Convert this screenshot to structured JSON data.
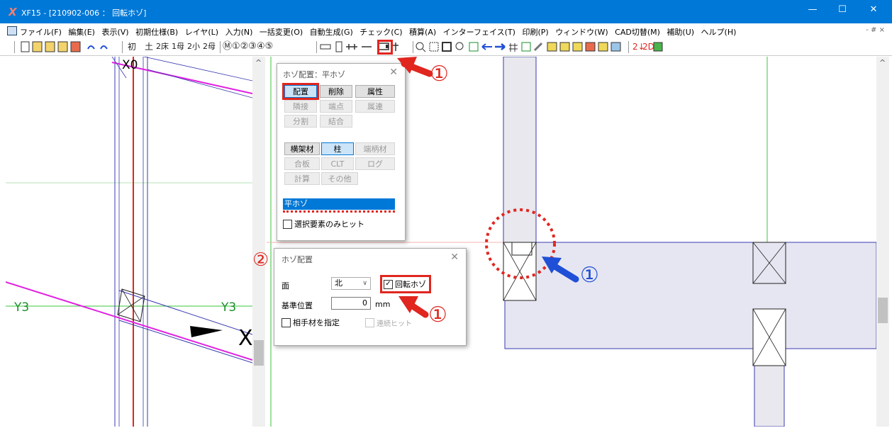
{
  "window": {
    "title": "XF15 - [210902-006 ： 回転ホゾ]",
    "app_icon": "xf15-app-icon",
    "controls": {
      "minimize": "—",
      "maximize": "☐",
      "close": "✕"
    }
  },
  "menubar": {
    "items": [
      "ファイル(F)",
      "編集(E)",
      "表示(V)",
      "初期仕様(B)",
      "レイヤ(L)",
      "入力(N)",
      "一括変更(O)",
      "自動生成(G)",
      "チェック(C)",
      "積算(A)",
      "インターフェイス(T)",
      "印刷(P)",
      "ウィンドウ(W)",
      "CAD切替(M)",
      "補助(U)",
      "ヘルプ(H)"
    ],
    "mdi_controls": "-  #  ×"
  },
  "toolbar": {
    "floor_labels": [
      "初",
      "土",
      "2床",
      "1母",
      "2小",
      "2母"
    ],
    "layer_labels": "Ⓜ①②③④⑤",
    "red_labels": [
      "2↓",
      "2D"
    ]
  },
  "canvas_left": {
    "labels": {
      "x0": "X0",
      "y3_left": "Y3",
      "y3_right": "Y3",
      "x_axis": "X"
    }
  },
  "dialog_hozo_main": {
    "title": "ホゾ配置：平ホゾ",
    "close": "✕",
    "action_buttons": [
      "配置",
      "削除",
      "属性",
      "隣接",
      "端点",
      "属連",
      "分割",
      "結合"
    ],
    "member_buttons": [
      "横架材",
      "柱",
      "端柄材",
      "合板",
      "CLT",
      "ログ",
      "計算",
      "その他"
    ],
    "list_selected": "平ホゾ",
    "hit_selected_only_label": "選択要素のみヒット",
    "hit_selected_only_checked": false
  },
  "dialog_hozo_place": {
    "title": "ホゾ配置",
    "close": "✕",
    "face_label": "面",
    "face_value": "北",
    "rotate_label": "回転ホゾ",
    "rotate_checked": true,
    "base_label": "基準位置",
    "base_value": "0",
    "base_unit": "mm",
    "partner_label": "相手材を指定",
    "partner_checked": false,
    "continuous_label": "連続ヒット",
    "continuous_checked": false
  },
  "annotations": {
    "marker_1": "①",
    "marker_2": "②",
    "colors": {
      "red": "#e0261f",
      "blue": "#1f4fd6"
    }
  }
}
